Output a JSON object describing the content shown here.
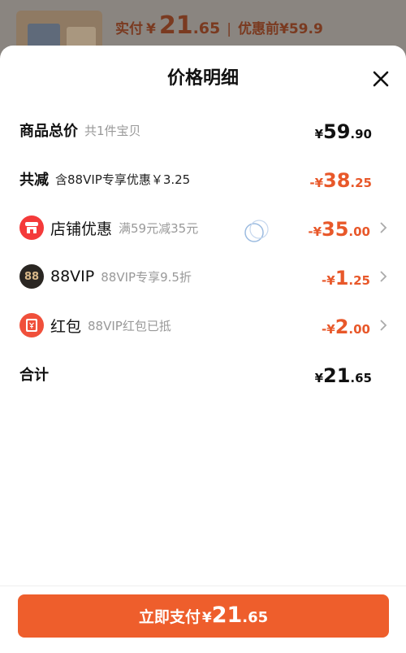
{
  "background": {
    "paid_label": "实付",
    "paid_yen": "¥",
    "paid_int": "21",
    "paid_dec": ".65",
    "separator": "|",
    "original_text": "优惠前¥59.9"
  },
  "sheet": {
    "title": "价格明细",
    "close_icon": "close-icon"
  },
  "rows": {
    "total": {
      "label": "商品总价",
      "sub": "共1件宝贝",
      "yen": "¥",
      "int": "59",
      "dec": ".90"
    },
    "discount": {
      "label": "共减",
      "sub": "含88VIP专享优惠￥3.25",
      "yen": "-¥",
      "int": "38",
      "dec": ".25"
    },
    "store": {
      "icon": "store-icon",
      "label": "店铺优惠",
      "sub": "满59元减35元",
      "yen": "-¥",
      "int": "35",
      "dec": ".00"
    },
    "vip": {
      "icon": "vip88-icon",
      "icon_text": "88",
      "label": "88VIP",
      "sub": "88VIP专享9.5折",
      "yen": "-¥",
      "int": "1",
      "dec": ".25"
    },
    "redpack": {
      "icon": "red-envelope-icon",
      "label": "红包",
      "sub": "88VIP红包已抵",
      "yen": "-¥",
      "int": "2",
      "dec": ".00"
    },
    "sum": {
      "label": "合计",
      "yen": "¥",
      "int": "21",
      "dec": ".65"
    }
  },
  "footer": {
    "pay_label": "立即支付",
    "pay_yen": "¥",
    "pay_int": "21",
    "pay_dec": ".65"
  },
  "colors": {
    "accent": "#ee5e2c",
    "discount_text": "#e8582a"
  }
}
